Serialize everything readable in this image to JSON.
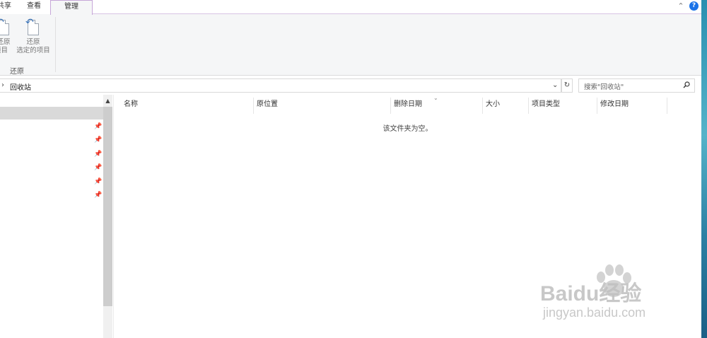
{
  "ribbon": {
    "tabs": {
      "share": "共享",
      "view": "查看",
      "manage": "管理"
    },
    "buttons": {
      "restore_all_line1": "还原",
      "restore_all_line2": "所有项目",
      "restore_selected_line1": "还原",
      "restore_selected_line2": "选定的项目"
    },
    "group_label": "还原"
  },
  "address": {
    "path": "回收站"
  },
  "search": {
    "placeholder": "搜索\"回收站\""
  },
  "columns": [
    "名称",
    "原位置",
    "删除日期",
    "大小",
    "项目类型",
    "修改日期"
  ],
  "content": {
    "empty_message": "该文件夹为空。"
  },
  "watermark": {
    "title": "Baidu经验",
    "url": "jingyan.baidu.com"
  },
  "colors": {
    "accent": "#1a73e8",
    "tab_border": "#c6a6d8"
  }
}
